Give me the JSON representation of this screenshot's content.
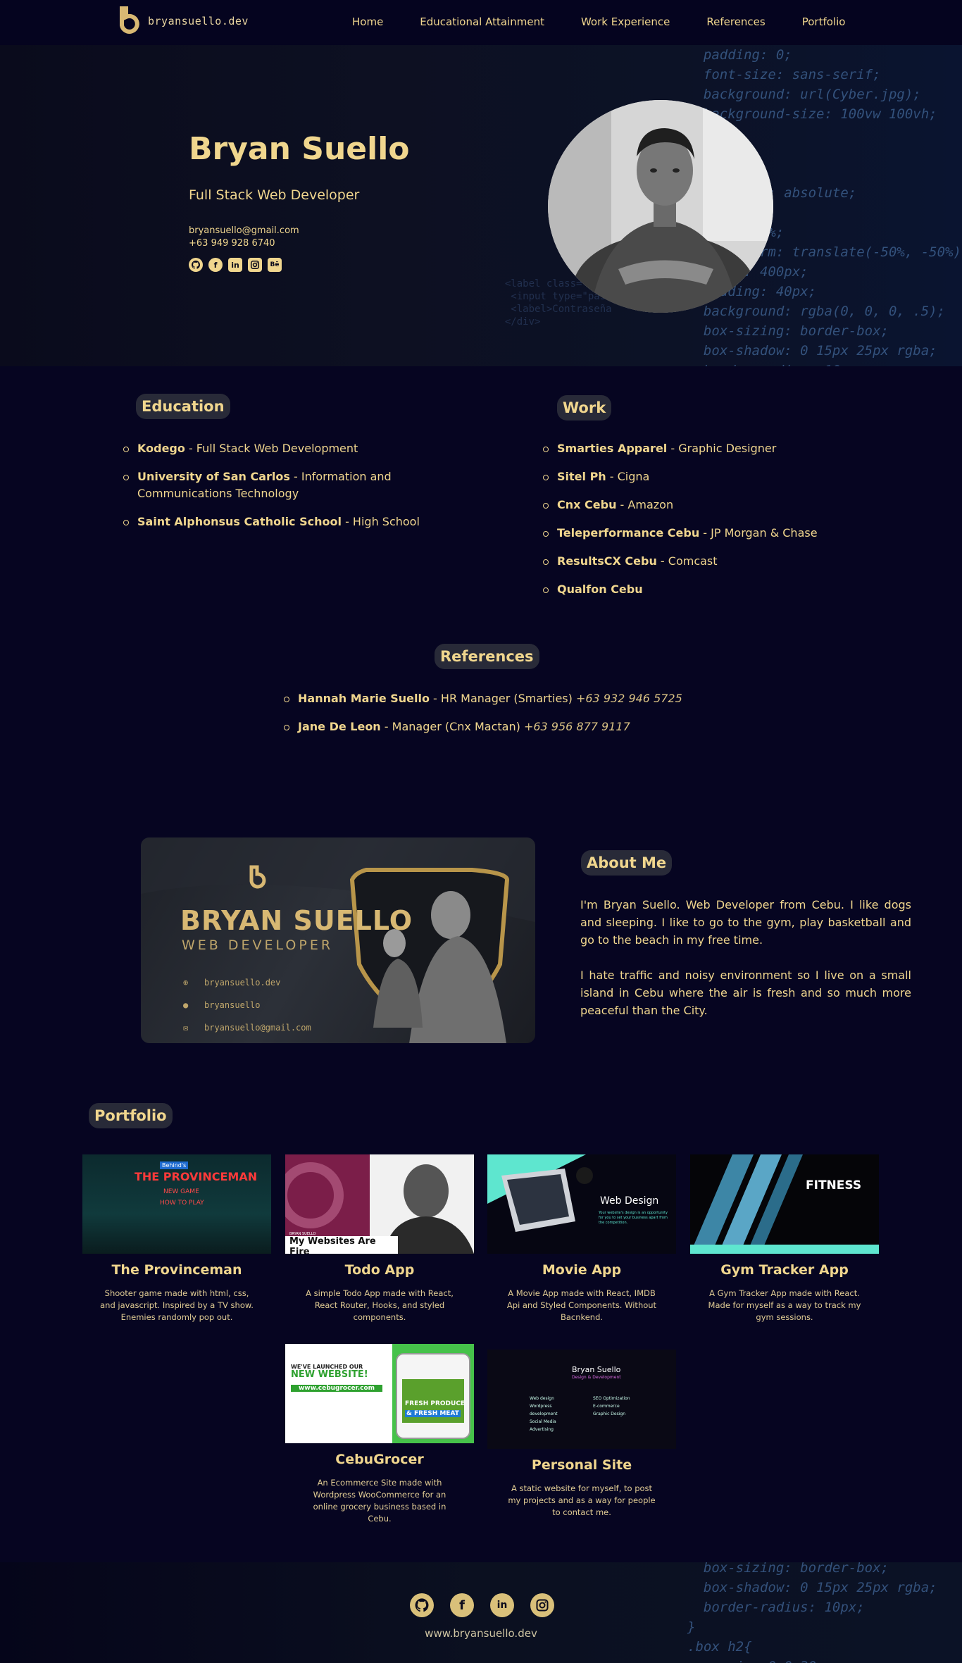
{
  "nav": {
    "logo_text": "bryansuello.dev",
    "links": [
      "Home",
      "Educational Attainment",
      "Work Experience",
      "References",
      "Portfolio"
    ]
  },
  "hero": {
    "name": "Bryan Suello",
    "role": "Full Stack Web Developer",
    "email": "bryansuello@gmail.com",
    "phone": "+63 949 928 6740",
    "socials": [
      "github-icon",
      "facebook-icon",
      "linkedin-icon",
      "instagram-icon",
      "behance-icon"
    ],
    "behance_label": "Bē"
  },
  "education": {
    "tag": "Education",
    "items": [
      {
        "school": "Kodego",
        "detail": " - Full Stack Web Development"
      },
      {
        "school": "University of San Carlos",
        "detail": " - Information and Communications Technology"
      },
      {
        "school": "Saint Alphonsus Catholic School",
        "detail": " - High School"
      }
    ]
  },
  "work": {
    "tag": "Work",
    "items": [
      {
        "company": "Smarties Apparel",
        "detail": " - Graphic Designer"
      },
      {
        "company": "Sitel Ph",
        "detail": " - Cigna"
      },
      {
        "company": "Cnx Cebu",
        "detail": " - Amazon"
      },
      {
        "company": "Teleperformance Cebu",
        "detail": " - JP Morgan & Chase"
      },
      {
        "company": "ResultsCX Cebu",
        "detail": " - Comcast"
      },
      {
        "company": "Qualfon Cebu",
        "detail": ""
      }
    ]
  },
  "references": {
    "tag": "References",
    "items": [
      {
        "name": "Hannah Marie Suello",
        "role": " - HR Manager (Smarties) ",
        "phone": "+63 932 946 5725"
      },
      {
        "name": "Jane De Leon",
        "role": " - Manager (Cnx Mactan) ",
        "phone": "+63 956 877 9117"
      }
    ]
  },
  "about": {
    "tag": "About Me",
    "card": {
      "name": "BRYAN SUELLO",
      "title": "WEB DEVELOPER",
      "site": "bryansuello.dev",
      "github": "bryansuello",
      "email": "bryansuello@gmail.com"
    },
    "paragraphs": [
      "I'm Bryan Suello. Web Developer from Cebu. I like dogs and sleeping. I like to go to the gym, play basketball and go to the beach in my free time.",
      "I hate traffic and noisy environment so I live on a small island in Cebu where the air is fresh and so much more peaceful than the City."
    ]
  },
  "portfolio": {
    "tag": "Portfolio",
    "projects": [
      {
        "title": "The Provinceman",
        "desc": "Shooter game made with html, css, and javascript. Inspired by a TV show. Enemies randomly pop out.",
        "thumb_text": [
          "Behind's",
          "THE PROVINCEMAN",
          "NEW GAME",
          "HOW TO PLAY"
        ]
      },
      {
        "title": "Todo App",
        "desc": "A simple Todo App made with React, React Router, Hooks, and styled components.",
        "thumb_text": [
          "BRYAN SUELLO",
          "My Websites Are Fire"
        ]
      },
      {
        "title": "Movie App",
        "desc": "A Movie App made with React, IMDB Api and Styled Components. Without Bacnkend.",
        "thumb_text": [
          "Web Design",
          "Your website's design is an opportunity for you to set your business apart from the competition."
        ]
      },
      {
        "title": "Gym Tracker App",
        "desc": "A Gym Tracker App made with React. Made for myself as a way to track my gym sessions.",
        "thumb_text": [
          "FITNESS"
        ]
      },
      {
        "title": "CebuGrocer",
        "desc": "An Ecommerce Site made with Wordpress WooCommerce for an online grocery business based in Cebu.",
        "thumb_text": [
          "WE'VE LAUNCHED OUR",
          "NEW WEBSITE!",
          "www.cebugrocer.com",
          "FRESH PRODUCE",
          "& FRESH MEAT"
        ]
      },
      {
        "title": "Personal Site",
        "desc": "A static website for myself, to post my projects and as a way for people to contact me.",
        "thumb_text": [
          "Bryan Suello",
          "Design & Development",
          "Web design",
          "Wordpress development",
          "Social Media Advertising",
          "SEO Optimization",
          "E-commerce",
          "Graphic Design"
        ]
      }
    ]
  },
  "footer": {
    "icons": [
      "github-icon",
      "facebook-icon",
      "linkedin-icon",
      "instagram-icon"
    ],
    "url": "www.bryansuello.dev"
  },
  "colors": {
    "accent": "#f0d68e",
    "background": "#060521",
    "tag_bg": "#282a38"
  }
}
